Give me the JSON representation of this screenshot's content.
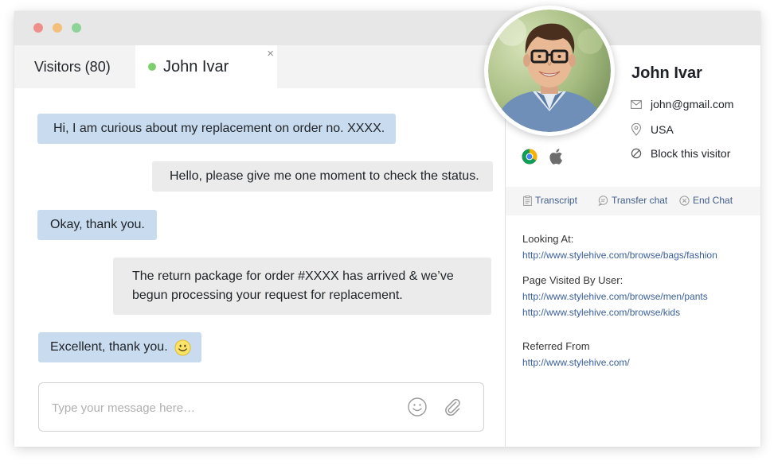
{
  "tabs": {
    "visitors_label": "Visitors (80)",
    "active_label": "John Ivar",
    "close_glyph": "×"
  },
  "messages": [
    {
      "from": "visitor",
      "text": "Hi, I am curious about my replacement on order no. XXXX."
    },
    {
      "from": "agent",
      "text": "Hello, please give me one moment to check the status."
    },
    {
      "from": "visitor",
      "text": "Okay, thank you."
    },
    {
      "from": "agent",
      "text": "The return package for order #XXXX has arrived & we’ve begun processing your request for replacement."
    },
    {
      "from": "visitor",
      "text": "Excellent, thank you.",
      "emoji": "smiley-icon"
    }
  ],
  "composer": {
    "placeholder": "Type your message here…",
    "emoji_icon": "smiley-icon",
    "attach_icon": "paperclip-icon"
  },
  "visitor": {
    "name": "John Ivar",
    "email": "john@gmail.com",
    "country": "USA",
    "block_label": "Block this visitor",
    "browsers": [
      "chrome-icon",
      "apple-icon"
    ]
  },
  "actions": {
    "transcript": "Transcript",
    "transfer": "Transfer chat",
    "end": "End Chat"
  },
  "browsing": {
    "looking_at_label": "Looking At:",
    "looking_at_url": "http://www.stylehive.com/browse/bags/fashion",
    "visited_label": "Page Visited By User:",
    "visited_urls": [
      "http://www.stylehive.com/browse/men/pants",
      "http://www.stylehive.com/browse/kids"
    ],
    "referred_label": "Referred From",
    "referred_url": "http://www.stylehive.com/"
  },
  "colors": {
    "visitor_bubble": "#c9dcef",
    "agent_bubble": "#ebebeb",
    "online_dot": "#7ccf6d",
    "link": "#3a5f9b"
  }
}
